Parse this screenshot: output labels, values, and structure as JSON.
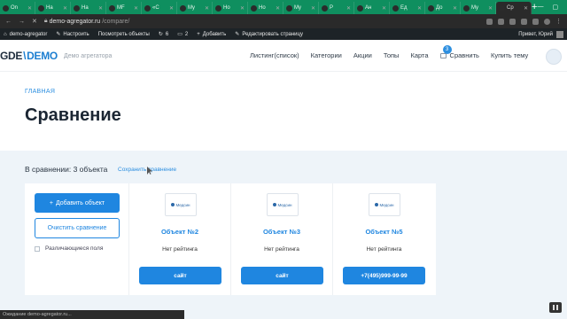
{
  "browser": {
    "tabs": [
      {
        "label": "On",
        "active": false
      },
      {
        "label": "На",
        "active": false
      },
      {
        "label": "На",
        "active": false
      },
      {
        "label": "MF",
        "active": false
      },
      {
        "label": "«С",
        "active": false
      },
      {
        "label": "My",
        "active": false
      },
      {
        "label": "Но",
        "active": false
      },
      {
        "label": "Но",
        "active": false
      },
      {
        "label": "My",
        "active": false
      },
      {
        "label": "Р",
        "active": false
      },
      {
        "label": "Ан",
        "active": false
      },
      {
        "label": "Ед",
        "active": false
      },
      {
        "label": "До",
        "active": false
      },
      {
        "label": "My",
        "active": false
      },
      {
        "label": "Ср",
        "active": true
      }
    ],
    "new_tab_label": "+",
    "url_host": "demo-agregator.ru",
    "url_path": "/compare/"
  },
  "wp_bar": {
    "site_name": "demo-agregator",
    "customize": "Настроить",
    "view_objects": "Посмотреть объекты",
    "updates_count": "6",
    "comments_count": "2",
    "add_new": "Добавить",
    "edit_page": "Редактировать страницу",
    "greeting": "Привет, Юрий"
  },
  "header": {
    "logo_left": "GDE",
    "logo_right": "DEMO",
    "tagline": "Демо агрегатора",
    "nav": [
      "Листинг(список)",
      "Категории",
      "Акции",
      "Топы",
      "Карта"
    ],
    "compare_label": "Сравнить",
    "compare_count": "3",
    "buy_theme": "Купить тему"
  },
  "hero": {
    "breadcrumb": "ГЛАВНАЯ",
    "title": "Сравнение"
  },
  "compare": {
    "in_compare": "В сравнении: 3 объекта",
    "save_link": "Сохранить сравнение",
    "add_button": "Добавить объект",
    "clear_button": "Очистить сравнение",
    "diff_label": "Различающиеся поля",
    "objects": [
      {
        "logo": "Медсин",
        "name": "Объект №2",
        "rating": "Нет рейтинга",
        "button": "сайт"
      },
      {
        "logo": "Медсин",
        "name": "Объект №3",
        "rating": "Нет рейтинга",
        "button": "сайт"
      },
      {
        "logo": "Медсин",
        "name": "Объект №5",
        "rating": "Нет рейтинга",
        "button": "+7(495)999-99-99"
      }
    ]
  },
  "status_bar": "Ожидание demo-agregator.ru..."
}
